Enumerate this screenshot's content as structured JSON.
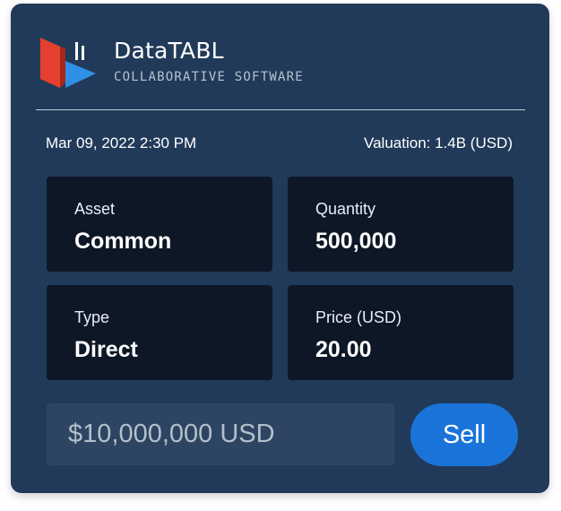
{
  "brand": {
    "name": "DataTABL",
    "tagline": "COLLABORATIVE SOFTWARE",
    "logo_icon": "datatabl-logo-icon",
    "colors": {
      "red": "#e8412f",
      "blue": "#2f8fe6",
      "bars": "#ffffff"
    }
  },
  "meta": {
    "datetime": "Mar 09, 2022 2:30 PM",
    "valuation": "Valuation: 1.4B (USD)"
  },
  "tiles": [
    {
      "label": "Asset",
      "value": "Common"
    },
    {
      "label": "Quantity",
      "value": "500,000"
    },
    {
      "label": "Type",
      "value": "Direct"
    },
    {
      "label": "Price (USD)",
      "value": "20.00"
    }
  ],
  "order": {
    "amount_value": "$10,000,000 USD",
    "sell_label": "Sell"
  },
  "colors": {
    "card_bg": "#213a59",
    "tile_bg": "#0d1726",
    "input_bg": "#2d4562",
    "accent": "#1a73d9"
  }
}
